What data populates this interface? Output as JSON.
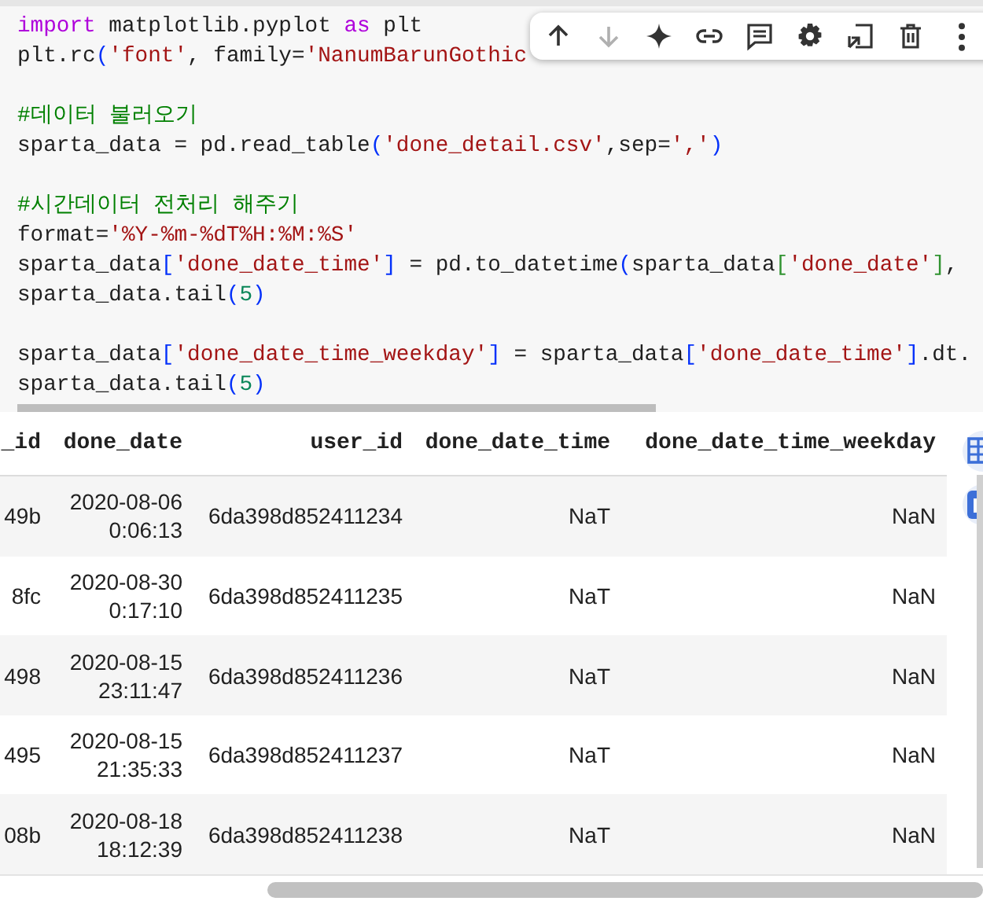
{
  "code_cell": {
    "lines": [
      {
        "kind": "code",
        "tokens": [
          {
            "text": "import",
            "kind": "keyword"
          },
          {
            "text": " matplotlib.pyplot ",
            "kind": "plain"
          },
          {
            "text": "as",
            "kind": "keyword"
          },
          {
            "text": " plt",
            "kind": "plain"
          }
        ]
      },
      {
        "kind": "code",
        "tokens": [
          {
            "text": "plt.rc",
            "kind": "plain"
          },
          {
            "text": "(",
            "kind": "paren"
          },
          {
            "text": "'font'",
            "kind": "string"
          },
          {
            "text": ", family=",
            "kind": "plain"
          },
          {
            "text": "'NanumBarunGothic",
            "kind": "string"
          }
        ]
      },
      {
        "kind": "blank"
      },
      {
        "kind": "code",
        "tokens": [
          {
            "text": "#데이터 불러오기",
            "kind": "comment"
          }
        ]
      },
      {
        "kind": "code",
        "tokens": [
          {
            "text": "sparta_data = pd.read_table",
            "kind": "plain"
          },
          {
            "text": "(",
            "kind": "paren"
          },
          {
            "text": "'done_detail.csv'",
            "kind": "string"
          },
          {
            "text": ",sep=",
            "kind": "plain"
          },
          {
            "text": "','",
            "kind": "string"
          },
          {
            "text": ")",
            "kind": "paren"
          }
        ]
      },
      {
        "kind": "blank"
      },
      {
        "kind": "code",
        "tokens": [
          {
            "text": "#시간데이터 전처리 해주기",
            "kind": "comment"
          }
        ]
      },
      {
        "kind": "code",
        "tokens": [
          {
            "text": "format=",
            "kind": "plain"
          },
          {
            "text": "'%Y-%m-%dT%H:%M:%S'",
            "kind": "string"
          }
        ]
      },
      {
        "kind": "code",
        "tokens": [
          {
            "text": "sparta_data",
            "kind": "plain"
          },
          {
            "text": "[",
            "kind": "paren"
          },
          {
            "text": "'done_date_time'",
            "kind": "string"
          },
          {
            "text": "]",
            "kind": "paren"
          },
          {
            "text": " = pd.to_datetime",
            "kind": "plain"
          },
          {
            "text": "(",
            "kind": "paren"
          },
          {
            "text": "sparta_data",
            "kind": "plain"
          },
          {
            "text": "[",
            "kind": "bracket"
          },
          {
            "text": "'done_date'",
            "kind": "string"
          },
          {
            "text": "]",
            "kind": "bracket"
          },
          {
            "text": ",",
            "kind": "plain"
          }
        ]
      },
      {
        "kind": "code",
        "tokens": [
          {
            "text": "sparta_data.tail",
            "kind": "plain"
          },
          {
            "text": "(",
            "kind": "paren"
          },
          {
            "text": "5",
            "kind": "number"
          },
          {
            "text": ")",
            "kind": "paren"
          }
        ]
      },
      {
        "kind": "blank"
      },
      {
        "kind": "code",
        "tokens": [
          {
            "text": "sparta_data",
            "kind": "plain"
          },
          {
            "text": "[",
            "kind": "paren"
          },
          {
            "text": "'done_date_time_weekday'",
            "kind": "string"
          },
          {
            "text": "]",
            "kind": "paren"
          },
          {
            "text": " = sparta_data",
            "kind": "plain"
          },
          {
            "text": "[",
            "kind": "paren"
          },
          {
            "text": "'done_date_time'",
            "kind": "string"
          },
          {
            "text": "]",
            "kind": "paren"
          },
          {
            "text": ".dt.",
            "kind": "plain"
          }
        ]
      },
      {
        "kind": "code",
        "tokens": [
          {
            "text": "sparta_data.tail",
            "kind": "plain"
          },
          {
            "text": "(",
            "kind": "paren"
          },
          {
            "text": "5",
            "kind": "number"
          },
          {
            "text": ")",
            "kind": "paren"
          }
        ]
      }
    ]
  },
  "cell_toolbar": [
    {
      "kind": "up",
      "disabled": false
    },
    {
      "kind": "down",
      "disabled": true
    },
    {
      "kind": "sparkle",
      "disabled": false
    },
    {
      "kind": "link",
      "disabled": false
    },
    {
      "kind": "comment",
      "disabled": false
    },
    {
      "kind": "gear",
      "disabled": false
    },
    {
      "kind": "export",
      "disabled": false
    },
    {
      "kind": "trash",
      "disabled": false
    },
    {
      "kind": "more",
      "disabled": false
    }
  ],
  "table": {
    "columns": [
      "_id",
      "done_date",
      "user_id",
      "done_date_time",
      "done_date_time_weekday"
    ],
    "rows": [
      [
        "49b",
        "2020-08-06 0:06:13",
        "6da398d852411234",
        "NaT",
        "NaN"
      ],
      [
        "8fc",
        "2020-08-30 0:17:10",
        "6da398d852411235",
        "NaT",
        "NaN"
      ],
      [
        "498",
        "2020-08-15 23:11:47",
        "6da398d852411236",
        "NaT",
        "NaN"
      ],
      [
        "495",
        "2020-08-15 21:35:33",
        "6da398d852411237",
        "NaT",
        "NaN"
      ],
      [
        "08b",
        "2020-08-18 18:12:39",
        "6da398d852411238",
        "NaT",
        "NaN"
      ]
    ]
  }
}
